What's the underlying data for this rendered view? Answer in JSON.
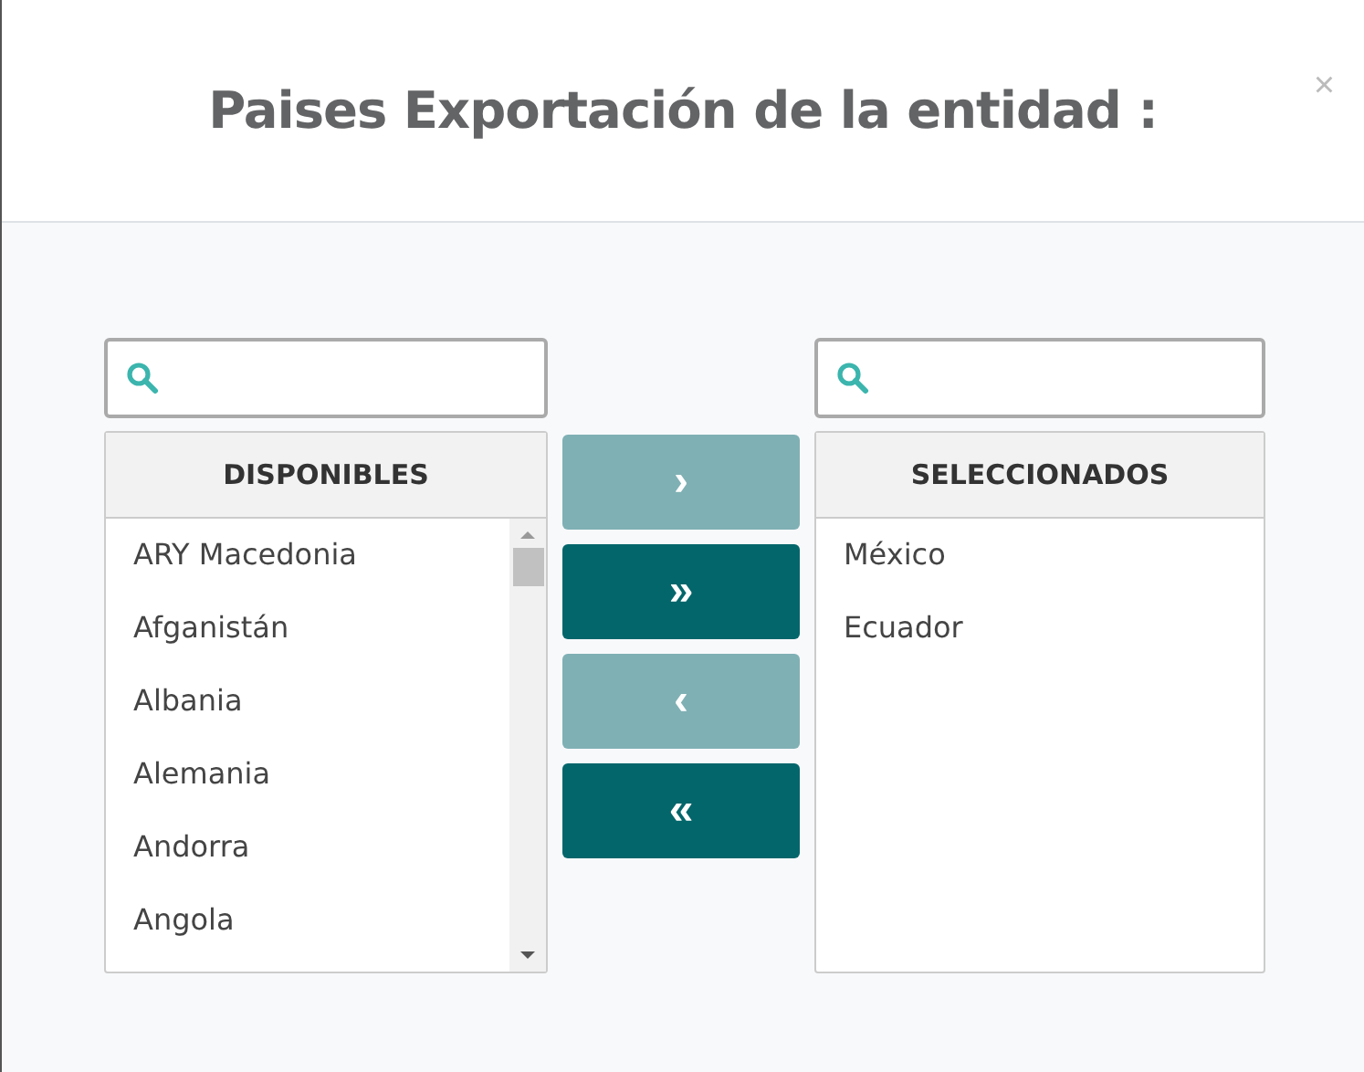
{
  "dialog": {
    "title": "Paises Exportación de la entidad :",
    "close": "×"
  },
  "available": {
    "heading": "DISPONIBLES",
    "items": [
      "ARY Macedonia",
      "Afganistán",
      "Albania",
      "Alemania",
      "Andorra",
      "Angola"
    ]
  },
  "buttons": [
    {
      "label": "›",
      "disabled": true
    },
    {
      "label": "»",
      "disabled": false
    },
    {
      "label": "‹",
      "disabled": true
    },
    {
      "label": "«",
      "disabled": false
    }
  ],
  "selected": {
    "heading": "SELECCIONADOS",
    "items": [
      "México",
      "Ecuador"
    ]
  }
}
